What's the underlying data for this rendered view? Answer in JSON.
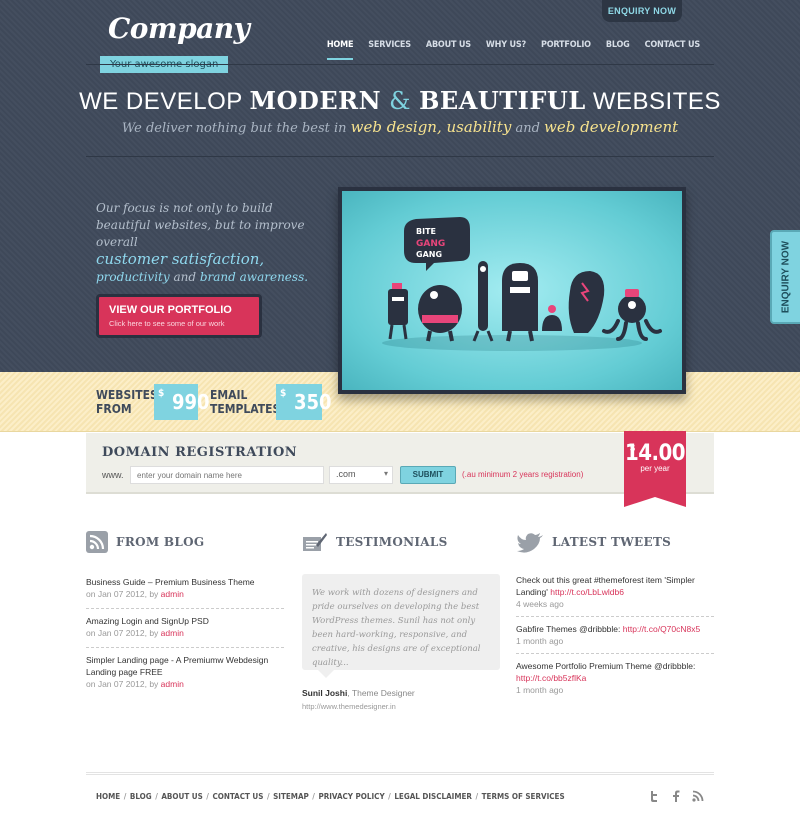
{
  "brand": {
    "name": "Company",
    "slogan": "Your awesome slogan"
  },
  "enquiry_top": "ENQUIRY NOW",
  "enquiry_side": "ENQUIRY NOW",
  "nav": [
    "HOME",
    "SERVICES",
    "ABOUT US",
    "WHY US?",
    "PORTFOLIO",
    "BLOG",
    "CONTACT US"
  ],
  "headline": {
    "p1": "WE DEVELOP ",
    "p2": "MODERN",
    "p3": " & ",
    "p4": "BEAUTIFUL",
    "p5": " WEBSITES"
  },
  "subhead": {
    "p1": "We deliver nothing but the best in ",
    "p2": "web design, usability",
    "p3": " and ",
    "p4": "web development"
  },
  "focus": {
    "p1": "Our focus is not only to build beautiful websites, but to improve overall",
    "p2": "customer satisfaction,",
    "p3": "productivity",
    "p4": " and ",
    "p5": "brand awareness."
  },
  "portfolio_btn": {
    "title": "VIEW OUR PORTFOLIO",
    "sub": "Click here to see some of our work"
  },
  "showcase": {
    "sign": "BITE GANG GANG"
  },
  "pricing": [
    {
      "label1": "WEBSITES",
      "label2": "FROM",
      "currency": "$",
      "amount": "990"
    },
    {
      "label1": "EMAIL",
      "label2": "TEMPLATES",
      "currency": "$",
      "amount": "350"
    }
  ],
  "domain": {
    "title": "DOMAIN REGISTRATION",
    "prefix": "www.",
    "placeholder": "enter your domain name here",
    "tld": ".com",
    "submit": "SUBMIT",
    "note": "(.au minimum 2 years registration)",
    "currency": "$",
    "price": "14.00",
    "per": "per year"
  },
  "blog": {
    "title": "FROM BLOG",
    "items": [
      {
        "title": "Business Guide – Premium Business Theme",
        "date": "on Jan 07 2012, by ",
        "author": "admin"
      },
      {
        "title": "Amazing Login and SignUp PSD",
        "date": "on Jan 07 2012, by ",
        "author": "admin"
      },
      {
        "title": "Simpler Landing page - A Premiumw Webdesign Landing page FREE",
        "date": "on Jan 07 2012, by ",
        "author": "admin"
      }
    ]
  },
  "testimonials": {
    "title": "TESTIMONIALS",
    "quote": "We work with dozens of designers and pride ourselves on developing the best WordPress themes. Sunil has not only been hard-working, responsive, and creative, his designs are of exceptional quality...",
    "name": "Sunil Joshi",
    "role": ", Theme Designer",
    "url": "http://www.themedesigner.in"
  },
  "tweets": {
    "title": "LATEST TWEETS",
    "items": [
      {
        "text": "Check out this great #themeforest item 'Simpler Landing' ",
        "link": "http://t.co/LbLwldb6",
        "time": "4 weeks ago"
      },
      {
        "text": "Gabfire Themes @dribbble: ",
        "link": "http://t.co/Q70cN8x5",
        "time": "1 month ago"
      },
      {
        "text": "Awesome Portfolio Premium Theme @dribbble: ",
        "link": "http://t.co/bb5zflKa",
        "time": "1 month ago"
      }
    ]
  },
  "footer": {
    "links": [
      "HOME",
      "BLOG",
      "ABOUT US",
      "CONTACT US",
      "SITEMAP",
      "PRIVACY POLICY",
      "LEGAL DISCLAIMER",
      "TERMS OF SERVICES"
    ],
    "separator": " / "
  },
  "social": [
    "twitter-icon",
    "facebook-icon",
    "rss-icon"
  ],
  "colors": {
    "hero": "#3f4a5b",
    "accent": "#7fd3e0",
    "pink": "#d8345a",
    "tan": "#fbe9b5"
  }
}
